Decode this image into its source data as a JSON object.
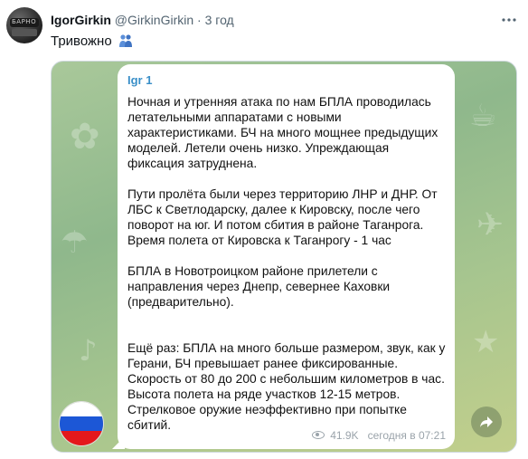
{
  "tweet": {
    "author_name": "IgorGirkin",
    "author_handle": "@GirkinGirkin",
    "separator": "·",
    "time": "3 год",
    "text": "Тривожно",
    "more_icon": "ellipsis-icon",
    "avatar_caption": "БАРНО"
  },
  "telegram": {
    "sender": "Igr 1",
    "message": "Ночная и утренняя атака по нам БПЛА проводилась летательными аппаратами с новыми характеристиками. БЧ на много мощнее предыдущих моделей. Летели очень низко. Упреждающая фиксация затруднена.\n\nПути пролёта были через территорию ЛНР и ДНР. От ЛБС к Светлодарску, далее к Кировску, после чего поворот на юг. И потом сбития в районе Таганрога.\nВремя полета от Кировска к Таганрогу - 1 час\n\nБПЛА в Новотроицком районе прилетели с направления через Днепр, севернее Каховки (предварительно).\n\n\nЕщё раз: БПЛА на много больше размером, звук, как у Герани, БЧ превышает ранее фиксированные. Скорость от 80 до 200 с небольшим километров в час. Высота полета на ряде участков 12-15 метров. Стрелковое оружие неэффективно при попытке сбитий.",
    "views": "41.9K",
    "timestamp": "сегодня в 07:21",
    "flag_colors": [
      "#ffffff",
      "#1c57d6",
      "#e4181c"
    ],
    "forward_icon": "forward-arrow-icon"
  },
  "colors": {
    "sender_accent": "#3a8fc8",
    "chat_background": "#9dc08f"
  }
}
